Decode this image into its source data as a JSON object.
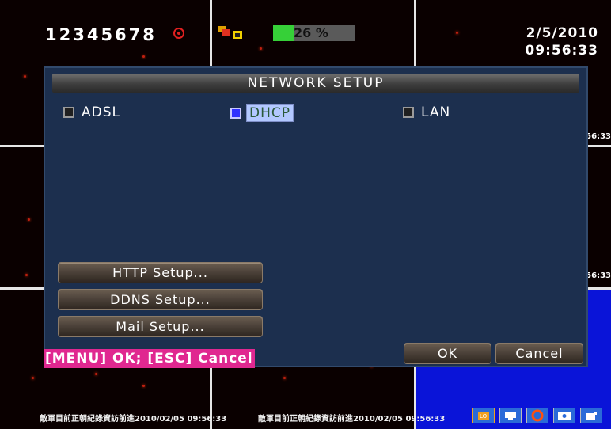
{
  "topbar": {
    "camera_numbers": "12345678",
    "hdd_percent": 26,
    "hdd_label": "26 %",
    "date": "2/5/2010",
    "time": "09:56:33"
  },
  "dialog": {
    "title": "NETWORK SETUP",
    "options": [
      {
        "label": "ADSL",
        "selected": false
      },
      {
        "label": "DHCP",
        "selected": true
      },
      {
        "label": "LAN",
        "selected": false
      }
    ],
    "http_setup": "HTTP Setup...",
    "ddns_setup": "DDNS Setup...",
    "mail_setup": "Mail Setup...",
    "hint": "[MENU] OK; [ESC] Cancel",
    "ok": "OK",
    "cancel": "Cancel"
  },
  "side_times": [
    ":56:33",
    ":56:33"
  ],
  "bottom_stamps": [
    "敵軍目前正朝紀錄資訪前進2010/02/05 09:56:33",
    "敵軍目前正朝紀錄資訪前進2010/02/05 09:56:33"
  ],
  "tray_icons": [
    "lo-icon",
    "monitor-icon",
    "record-circle-icon",
    "camera-icon",
    "cam2-icon"
  ],
  "colors": {
    "accent_blue": "#0a14d8",
    "dialog_bg": "#1c2f4e",
    "hint_bg": "#e02890",
    "hdd_fill": "#36d038"
  }
}
